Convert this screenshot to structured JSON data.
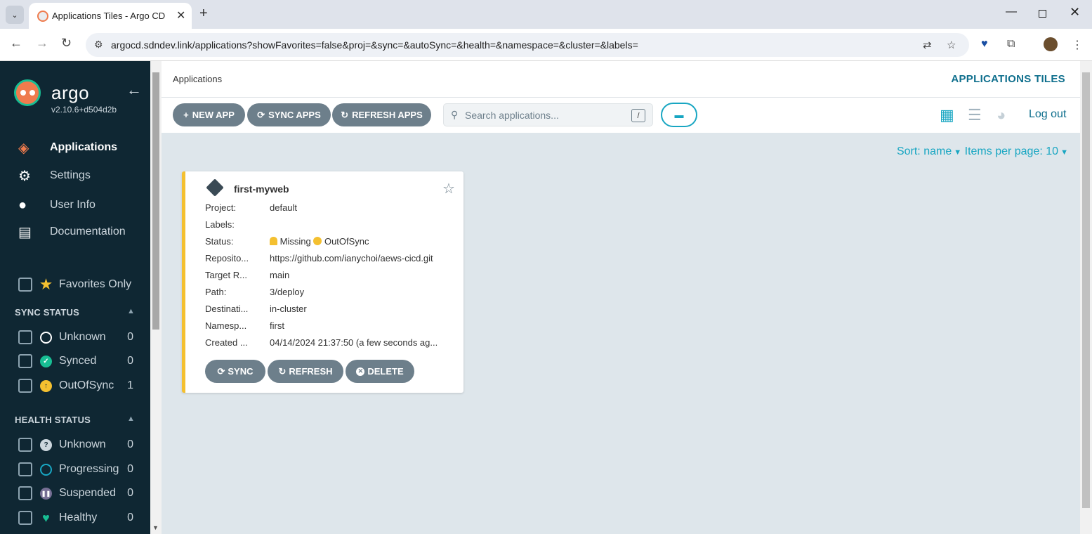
{
  "browser": {
    "tab_title": "Applications Tiles - Argo CD",
    "url": "argocd.sdndev.link/applications?showFavorites=false&proj=&sync=&autoSync=&health=&namespace=&cluster=&labels="
  },
  "sidebar": {
    "brand": "argo",
    "version": "v2.10.6+d504d2b",
    "nav": [
      {
        "label": "Applications",
        "icon": "layers-icon"
      },
      {
        "label": "Settings",
        "icon": "gear-icon"
      },
      {
        "label": "User Info",
        "icon": "user-circle-icon"
      },
      {
        "label": "Documentation",
        "icon": "book-icon"
      }
    ],
    "favorites_label": "Favorites Only",
    "sync_status": {
      "title": "SYNC STATUS",
      "items": [
        {
          "label": "Unknown",
          "count": "0"
        },
        {
          "label": "Synced",
          "count": "0"
        },
        {
          "label": "OutOfSync",
          "count": "1"
        }
      ]
    },
    "health_status": {
      "title": "HEALTH STATUS",
      "items": [
        {
          "label": "Unknown",
          "count": "0"
        },
        {
          "label": "Progressing",
          "count": "0"
        },
        {
          "label": "Suspended",
          "count": "0"
        },
        {
          "label": "Healthy",
          "count": "0"
        }
      ]
    }
  },
  "header": {
    "breadcrumb": "Applications",
    "title": "APPLICATIONS TILES"
  },
  "actions": {
    "new_app": "NEW APP",
    "sync_apps": "SYNC APPS",
    "refresh_apps": "REFRESH APPS",
    "search_placeholder": "Search applications...",
    "search_shortcut": "/",
    "logout": "Log out"
  },
  "sort": {
    "sort_label": "Sort: name",
    "items_label": "Items per page: 10"
  },
  "app_card": {
    "name": "first-myweb",
    "rows": [
      {
        "label": "Project:",
        "value": "default"
      },
      {
        "label": "Labels:",
        "value": ""
      },
      {
        "label": "Status:",
        "value": ""
      },
      {
        "label": "Reposito...",
        "value": "https://github.com/ianychoi/aews-cicd.git"
      },
      {
        "label": "Target R...",
        "value": "main"
      },
      {
        "label": "Path:",
        "value": "3/deploy"
      },
      {
        "label": "Destinati...",
        "value": "in-cluster"
      },
      {
        "label": "Namesp...",
        "value": "first"
      },
      {
        "label": "Created ...",
        "value": "04/14/2024 21:37:50  (a few seconds ag..."
      }
    ],
    "health": "Missing",
    "sync": "OutOfSync",
    "buttons": {
      "sync": "SYNC",
      "refresh": "REFRESH",
      "delete": "DELETE"
    }
  },
  "colors": {
    "sidebar_bg": "#0f2733",
    "accent_orange": "#ef7b4d",
    "accent_teal": "#18a6c2",
    "missing_yellow": "#f4c030",
    "synced_green": "#18be94",
    "button_gray": "#6d7f8b"
  }
}
